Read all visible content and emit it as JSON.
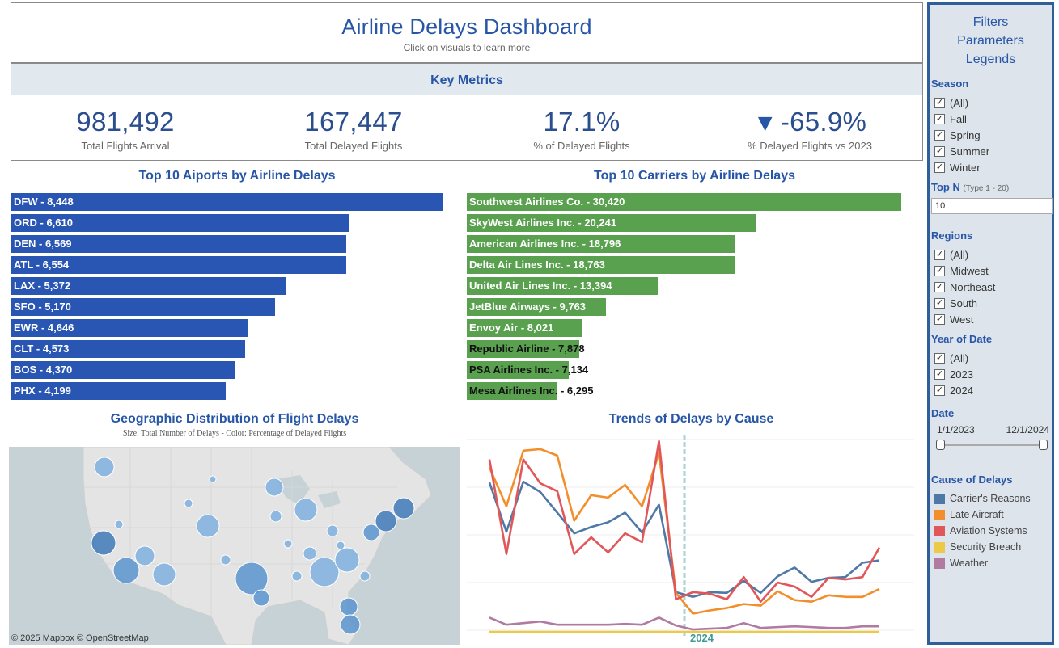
{
  "header": {
    "title": "Airline Delays Dashboard",
    "subtitle": "Click on visuals to learn more"
  },
  "key_metrics": {
    "heading": "Key Metrics",
    "items": [
      {
        "value": "981,492",
        "label": "Total Flights Arrival"
      },
      {
        "value": "167,447",
        "label": "Total Delayed Flights"
      },
      {
        "value": "17.1%",
        "label": "% of Delayed Flights"
      },
      {
        "value": "-65.9%",
        "label": "% Delayed Flights vs 2023",
        "indicator": "▼"
      }
    ]
  },
  "airports_title": "Top 10 Aiports by Airline Delays",
  "carriers_title": "Top 10 Carriers by Airline Delays",
  "map": {
    "title": "Geographic Distribution of Flight Delays",
    "subtitle": "Size: Total Number of Delays - Color: Percentage of Delayed Flights",
    "credit": "© 2025 Mapbox  © OpenStreetMap"
  },
  "trend_title": "Trends of Delays by Cause",
  "chart_data": [
    {
      "type": "bar",
      "title": "Top 10 Aiports by Airline Delays",
      "categories": [
        "DFW",
        "ORD",
        "DEN",
        "ATL",
        "LAX",
        "SFO",
        "EWR",
        "CLT",
        "BOS",
        "PHX"
      ],
      "values": [
        8448,
        6610,
        6569,
        6554,
        5372,
        5170,
        4646,
        4573,
        4370,
        4199
      ],
      "labels": [
        "DFW - 8,448",
        "ORD - 6,610",
        "DEN - 6,569",
        "ATL - 6,554",
        "LAX - 5,372",
        "SFO - 5,170",
        "EWR - 4,646",
        "CLT - 4,573",
        "BOS - 4,370",
        "PHX - 4,199"
      ],
      "color": "#2a56b3"
    },
    {
      "type": "bar",
      "title": "Top 10 Carriers by Airline Delays",
      "categories": [
        "Southwest Airlines Co.",
        "SkyWest Airlines Inc.",
        "American Airlines Inc.",
        "Delta Air Lines Inc.",
        "United Air Lines Inc.",
        "JetBlue Airways",
        "Envoy Air",
        "Republic Airline",
        "PSA Airlines Inc.",
        "Mesa Airlines Inc."
      ],
      "values": [
        30420,
        20241,
        18796,
        18763,
        13394,
        9763,
        8021,
        7878,
        7134,
        6295
      ],
      "labels": [
        "Southwest Airlines Co.  - 30,420",
        "SkyWest Airlines Inc.  - 20,241",
        "American Airlines Inc.  - 18,796",
        "Delta Air Lines Inc.  - 18,763",
        "United Air Lines Inc.  - 13,394",
        "JetBlue Airways  - 9,763",
        "Envoy Air  - 8,021",
        "Republic Airline  - 7,878",
        "PSA Airlines Inc.  - 7,134",
        "Mesa Airlines Inc.  - 6,295"
      ],
      "color": "#59a14f"
    },
    {
      "type": "line",
      "title": "Trends of Delays by Cause",
      "x": [
        "2023-01",
        "2023-02",
        "2023-03",
        "2023-04",
        "2023-05",
        "2023-06",
        "2023-07",
        "2023-08",
        "2023-09",
        "2023-10",
        "2023-11",
        "2023-12",
        "2024-01",
        "2024-02",
        "2024-03",
        "2024-04",
        "2024-05",
        "2024-06",
        "2024-07",
        "2024-08",
        "2024-09",
        "2024-10",
        "2024-11",
        "2024-12"
      ],
      "annotation": "2024",
      "ylim": [
        0,
        2400
      ],
      "series": [
        {
          "name": "Carrier's Reasons",
          "color": "#4e79a7",
          "values": [
            1900,
            1280,
            1910,
            1780,
            1520,
            1260,
            1340,
            1400,
            1520,
            1270,
            1620,
            520,
            460,
            520,
            510,
            660,
            510,
            720,
            830,
            650,
            700,
            710,
            890,
            920
          ]
        },
        {
          "name": "Late Aircraft",
          "color": "#f28e2b",
          "values": [
            2090,
            1600,
            2300,
            2320,
            2240,
            1420,
            1740,
            1710,
            1870,
            1600,
            2270,
            510,
            250,
            290,
            320,
            370,
            350,
            530,
            420,
            400,
            480,
            460,
            460,
            560
          ]
        },
        {
          "name": "Aviation Systems",
          "color": "#e15759",
          "values": [
            2190,
            1000,
            2190,
            1890,
            1790,
            1000,
            1210,
            1020,
            1260,
            1150,
            2420,
            430,
            520,
            500,
            430,
            710,
            400,
            640,
            590,
            460,
            700,
            680,
            710,
            1080
          ]
        },
        {
          "name": "Security Breach",
          "color": "#edc948",
          "values": [
            20,
            20,
            20,
            20,
            20,
            20,
            20,
            20,
            20,
            20,
            20,
            20,
            20,
            20,
            20,
            20,
            20,
            20,
            20,
            20,
            20,
            20,
            20,
            20
          ]
        },
        {
          "name": "Weather",
          "color": "#b07aa1",
          "values": [
            200,
            110,
            130,
            150,
            110,
            110,
            110,
            110,
            120,
            110,
            200,
            100,
            50,
            60,
            70,
            130,
            70,
            80,
            90,
            80,
            70,
            70,
            90,
            90
          ]
        }
      ]
    }
  ],
  "panel": {
    "titles": [
      "Filters",
      "Parameters",
      "Legends"
    ],
    "season": {
      "label": "Season",
      "options": [
        "(All)",
        "Fall",
        "Spring",
        "Summer",
        "Winter"
      ]
    },
    "topn": {
      "label": "Top N",
      "hint": "(Type 1 - 20)",
      "value": "10"
    },
    "regions": {
      "label": "Regions",
      "options": [
        "(All)",
        "Midwest",
        "Northeast",
        "South",
        "West"
      ]
    },
    "year": {
      "label": "Year of Date",
      "options": [
        "(All)",
        "2023",
        "2024"
      ]
    },
    "date": {
      "label": "Date",
      "start": "1/1/2023",
      "end": "12/1/2024"
    },
    "cause": {
      "label": "Cause of Delays",
      "items": [
        {
          "name": "Carrier's Reasons",
          "color": "#4e79a7"
        },
        {
          "name": "Late Aircraft",
          "color": "#f28e2b"
        },
        {
          "name": "Aviation Systems",
          "color": "#e15759"
        },
        {
          "name": "Security Breach",
          "color": "#edc948"
        },
        {
          "name": "Weather",
          "color": "#b07aa1"
        }
      ]
    }
  }
}
